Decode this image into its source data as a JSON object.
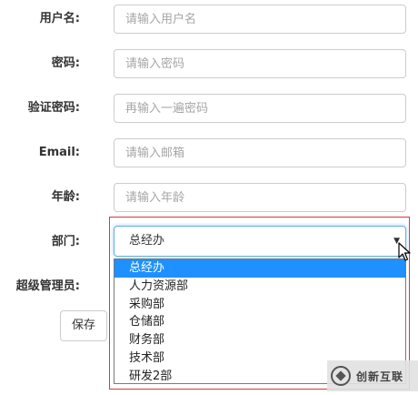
{
  "form": {
    "username": {
      "label": "用户名:",
      "placeholder": "请输入用户名"
    },
    "password": {
      "label": "密码:",
      "placeholder": "请输入密码"
    },
    "confirm_password": {
      "label": "验证密码:",
      "placeholder": "再输入一遍密码"
    },
    "email": {
      "label": "Email:",
      "placeholder": "请输入邮箱"
    },
    "age": {
      "label": "年龄:",
      "placeholder": "请输入年龄"
    },
    "department": {
      "label": "部门:",
      "selected": "总经办",
      "options": [
        "总经办",
        "人力资源部",
        "采购部",
        "仓储部",
        "财务部",
        "技术部",
        "研发2部"
      ]
    },
    "super_admin": {
      "label": "超级管理员:"
    },
    "save_label": "保存"
  },
  "watermark": {
    "text": "创新互联"
  },
  "colors": {
    "selected_option": "#1e90ff",
    "highlight_border": "#d43a3a",
    "focus_border": "#66afe9"
  }
}
